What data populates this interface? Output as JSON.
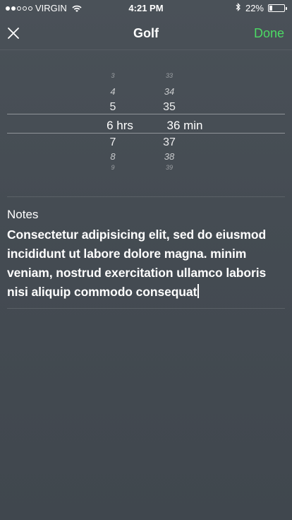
{
  "status_bar": {
    "carrier": "VIRGIN",
    "time": "4:21 PM",
    "battery_percent": "22%",
    "battery_level": 0.22,
    "signal_dots_filled": 2,
    "signal_dots_total": 5,
    "icons": [
      "wifi-icon",
      "bluetooth-icon",
      "battery-icon"
    ]
  },
  "nav": {
    "title": "Golf",
    "done_label": "Done",
    "close_icon": "close-icon",
    "accent_color": "#4cd964"
  },
  "picker": {
    "hours": {
      "above2": "3",
      "above1": "4",
      "prev": "5",
      "selected": "6 hrs",
      "next": "7",
      "below1": "8",
      "below2": "9"
    },
    "minutes": {
      "above2": "33",
      "above1": "34",
      "prev": "35",
      "selected": "36 min",
      "next": "37",
      "below1": "38",
      "below2": "39"
    }
  },
  "notes": {
    "label": "Notes",
    "text": "Consectetur adipisicing elit, sed do eiusmod incididunt ut labore dolore magna. minim veniam,  nostrud exercitation ullamco laboris nisi aliquip commodo consequat"
  }
}
